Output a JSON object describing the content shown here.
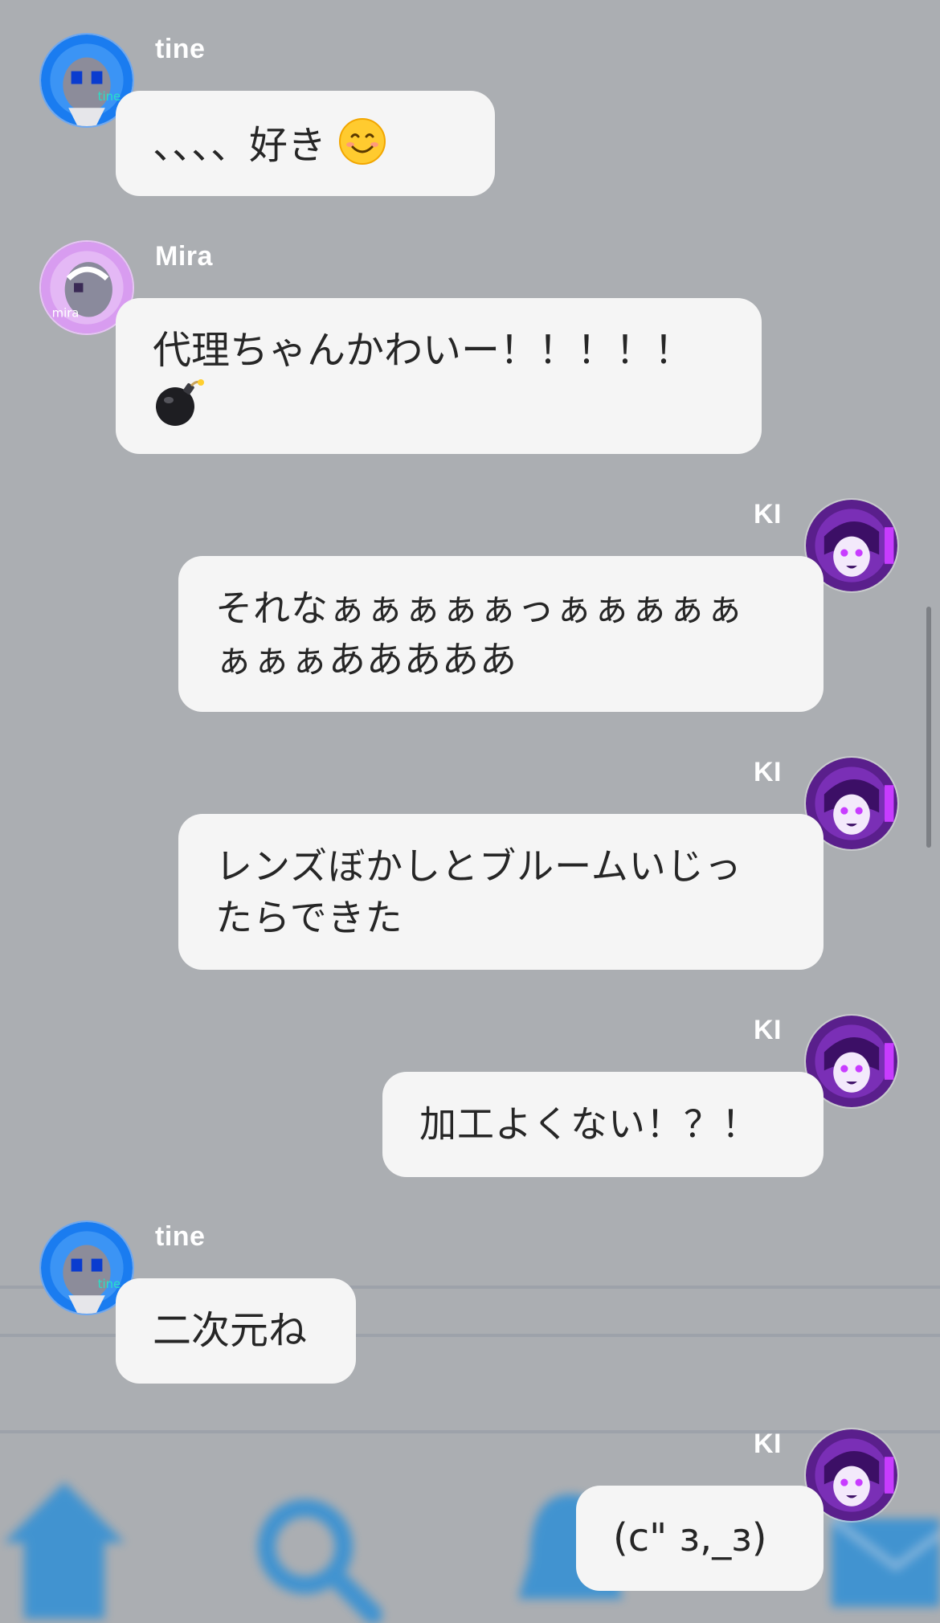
{
  "messages": [
    {
      "sender": "tine",
      "text": "、、、、好き",
      "emoji": "smiling-face-emoji",
      "side": "left"
    },
    {
      "sender": "Mira",
      "text_line1": "代理ちゃんかわいー！！！！！",
      "emoji": "bomb-emoji",
      "side": "left"
    },
    {
      "sender": "KI",
      "text_line1": "それなぁぁぁぁぁっぁぁぁぁぁ",
      "text_line2": "ぁぁぁあああああ",
      "side": "right"
    },
    {
      "sender": "KI",
      "text_line1": "レンズぼかしとブルームいじっ",
      "text_line2": "たらできた",
      "side": "right"
    },
    {
      "sender": "KI",
      "text": "加工よくない！？！",
      "side": "right"
    },
    {
      "sender": "tine",
      "text": "二次元ね",
      "side": "left"
    },
    {
      "sender": "KI",
      "text": "(c\" ɜ,_ɜ)",
      "side": "right"
    }
  ],
  "avatars": {
    "tine": {
      "label": "tine",
      "ring_color": "#1a7cf0",
      "accent": "#27e0c8"
    },
    "Mira": {
      "label": "mira",
      "ring_color": "#d89cf0",
      "accent": "#ffffff"
    },
    "KI": {
      "ring_color": "#5a1f8c",
      "accent": "#c83cff"
    }
  },
  "background_nav_icons": [
    "home-icon",
    "search-icon",
    "bell-icon",
    "mail-icon"
  ],
  "colors": {
    "background": "#abaeb2",
    "bubble": "#f5f5f5",
    "text": "#262626",
    "name": "#ffffff",
    "nav_blue": "#2f8fd6"
  }
}
